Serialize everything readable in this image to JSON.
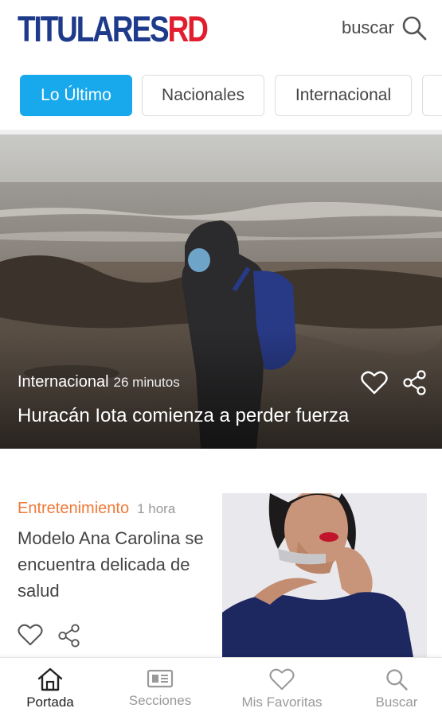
{
  "header": {
    "logo_part1": "TITULARES",
    "logo_part2": "RD",
    "search_label": "buscar"
  },
  "tabs": [
    {
      "label": "Lo Último",
      "active": true
    },
    {
      "label": "Nacionales",
      "active": false
    },
    {
      "label": "Internacional",
      "active": false
    }
  ],
  "hero": {
    "category": "Internacional",
    "time": "26 minutos",
    "title": "Huracán Iota comienza a perder fuerza"
  },
  "article": {
    "category": "Entretenimiento",
    "time": "1 hora",
    "title": "Modelo Ana Carolina se encuentra delicada de salud"
  },
  "bottom_nav": [
    {
      "label": "Portada",
      "icon": "home-icon",
      "active": true
    },
    {
      "label": "Secciones",
      "icon": "newspaper-icon",
      "active": false
    },
    {
      "label": "Mis Favoritas",
      "icon": "heart-icon",
      "active": false
    },
    {
      "label": "Buscar",
      "icon": "search-icon",
      "active": false
    }
  ],
  "colors": {
    "brand_blue": "#1e3a8a",
    "brand_red": "#e11d2e",
    "tab_active": "#18a8ec",
    "category_orange": "#f07a3a"
  }
}
